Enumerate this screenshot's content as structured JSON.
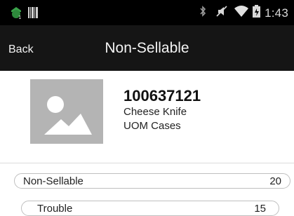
{
  "status_bar": {
    "time": "1:43",
    "icons": [
      "app-notification-icon",
      "barcode-icon",
      "bluetooth-icon",
      "muted-icon",
      "wifi-icon",
      "battery-icon"
    ]
  },
  "header": {
    "back_label": "Back",
    "title": "Non-Sellable"
  },
  "item": {
    "image_icon": "image-placeholder-icon",
    "number": "100637121",
    "description": "Cheese Knife",
    "uom": "UOM Cases"
  },
  "rows": [
    {
      "label": "Non-Sellable",
      "value": "20"
    },
    {
      "label": "Trouble",
      "value": "15"
    }
  ],
  "colors": {
    "status_bar": "#000000",
    "header": "#151515",
    "placeholder": "#b4b4b4"
  }
}
